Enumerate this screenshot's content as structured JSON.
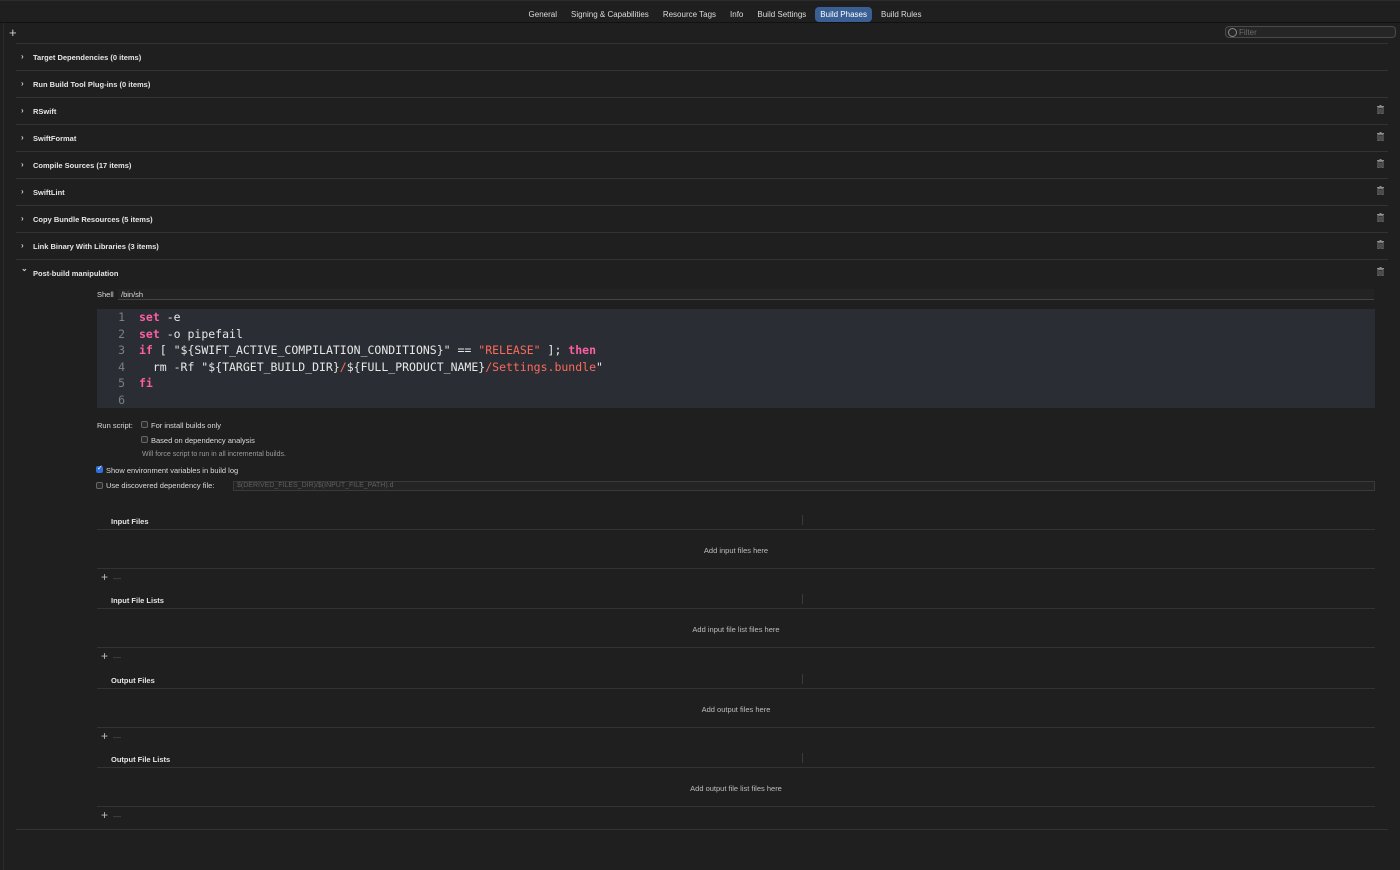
{
  "tabs": [
    {
      "label": "General",
      "active": false
    },
    {
      "label": "Signing & Capabilities",
      "active": false
    },
    {
      "label": "Resource Tags",
      "active": false
    },
    {
      "label": "Info",
      "active": false
    },
    {
      "label": "Build Settings",
      "active": false
    },
    {
      "label": "Build Phases",
      "active": true
    },
    {
      "label": "Build Rules",
      "active": false
    }
  ],
  "toolbar": {
    "add_symbol": "+",
    "filter_placeholder": "Filter"
  },
  "phases": [
    {
      "title": "Target Dependencies (0 items)",
      "expanded": false,
      "deletable": false
    },
    {
      "title": "Run Build Tool Plug-ins (0 items)",
      "expanded": false,
      "deletable": false
    },
    {
      "title": "RSwift",
      "expanded": false,
      "deletable": true
    },
    {
      "title": "SwiftFormat",
      "expanded": false,
      "deletable": true
    },
    {
      "title": "Compile Sources (17 items)",
      "expanded": false,
      "deletable": true
    },
    {
      "title": "SwiftLint",
      "expanded": false,
      "deletable": true
    },
    {
      "title": "Copy Bundle Resources (5 items)",
      "expanded": false,
      "deletable": true
    },
    {
      "title": "Link Binary With Libraries (3 items)",
      "expanded": false,
      "deletable": true
    },
    {
      "title": "Post-build manipulation",
      "expanded": true,
      "deletable": true
    }
  ],
  "script": {
    "shell_label": "Shell",
    "shell_value": "/bin/sh",
    "lines": [
      {
        "num": "1",
        "segments": [
          {
            "t": "set",
            "k": "kw"
          },
          {
            "t": " -e",
            "k": ""
          }
        ]
      },
      {
        "num": "2",
        "segments": [
          {
            "t": "set",
            "k": "kw"
          },
          {
            "t": " -o pipefail",
            "k": ""
          }
        ]
      },
      {
        "num": "3",
        "segments": [
          {
            "t": "if",
            "k": "kw"
          },
          {
            "t": " [ \"${SWIFT_ACTIVE_COMPILATION_CONDITIONS}\" == ",
            "k": ""
          },
          {
            "t": "\"RELEASE\"",
            "k": "str"
          },
          {
            "t": " ]; ",
            "k": ""
          },
          {
            "t": "then",
            "k": "kw"
          }
        ]
      },
      {
        "num": "4",
        "segments": [
          {
            "t": "  rm -Rf \"${TARGET_BUILD_DIR}",
            "k": ""
          },
          {
            "t": "/",
            "k": "str"
          },
          {
            "t": "${FULL_PRODUCT_NAME}",
            "k": ""
          },
          {
            "t": "/Settings.bundle",
            "k": "str"
          },
          {
            "t": "\"",
            "k": ""
          }
        ]
      },
      {
        "num": "5",
        "segments": [
          {
            "t": "fi",
            "k": "kw"
          }
        ]
      },
      {
        "num": "6",
        "segments": []
      }
    ]
  },
  "options": {
    "run_script_label": "Run script:",
    "install_builds_only": {
      "label": "For install builds only",
      "checked": false
    },
    "dependency_analysis": {
      "label": "Based on dependency analysis",
      "checked": false
    },
    "dependency_hint": "Will force script to run in all incremental builds.",
    "show_env_vars": {
      "label": "Show environment variables in build log",
      "checked": true
    },
    "discovered_dep_file": {
      "label": "Use discovered dependency file:",
      "checked": false,
      "placeholder": "$(DERIVED_FILES_DIR)/$(INPUT_FILE_PATH).d"
    }
  },
  "file_sections": [
    {
      "title": "Input Files",
      "empty_text": "Add input files here"
    },
    {
      "title": "Input File Lists",
      "empty_text": "Add input file list files here"
    },
    {
      "title": "Output Files",
      "empty_text": "Add output files here"
    },
    {
      "title": "Output File Lists",
      "empty_text": "Add output file list files here"
    }
  ],
  "list_controls": {
    "add": "+",
    "remove": "—"
  }
}
